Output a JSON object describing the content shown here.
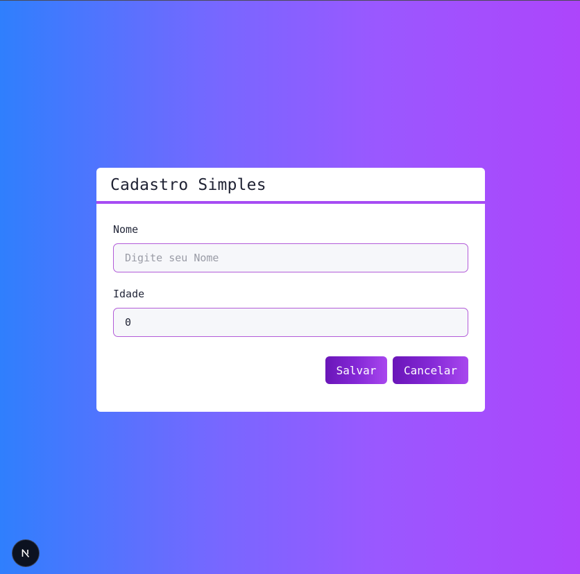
{
  "form": {
    "title": "Cadastro Simples",
    "name_label": "Nome",
    "name_placeholder": "Digite seu Nome",
    "name_value": "",
    "age_label": "Idade",
    "age_value": "0",
    "save_label": "Salvar",
    "cancel_label": "Cancelar"
  },
  "dev_badge": {
    "icon": "nextjs-logo-icon",
    "letter": "N"
  },
  "colors": {
    "gradient_start": "#2f7ffd",
    "gradient_end": "#ad45fb",
    "accent": "#a64cf3",
    "button": "#7a20cc"
  }
}
